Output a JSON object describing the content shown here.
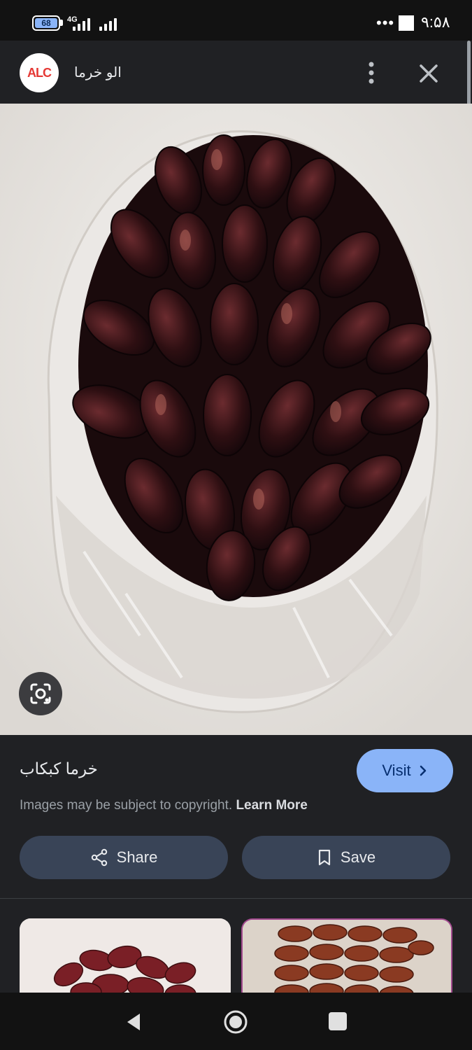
{
  "status_bar": {
    "battery_level": "68",
    "network_type": "4G",
    "overflow_dots": "•••",
    "time": "۹:۵۸"
  },
  "header": {
    "logo_text": "ALC",
    "site_title": "الو خرما"
  },
  "image": {
    "subject": "dates"
  },
  "info": {
    "caption": "خرما کبکاب",
    "visit_label": "Visit",
    "copyright_text": "Images may be subject to copyright.",
    "learn_more_label": "Learn More",
    "share_label": "Share",
    "save_label": "Save"
  },
  "colors": {
    "accent": "#8ab4f8",
    "background": "#202124",
    "button_fill": "#394457"
  },
  "icons": [
    "more-vert-icon",
    "close-icon",
    "google-lens-icon",
    "chevron-right-icon",
    "share-icon",
    "bookmark-icon",
    "back-icon",
    "home-icon",
    "recents-icon"
  ]
}
